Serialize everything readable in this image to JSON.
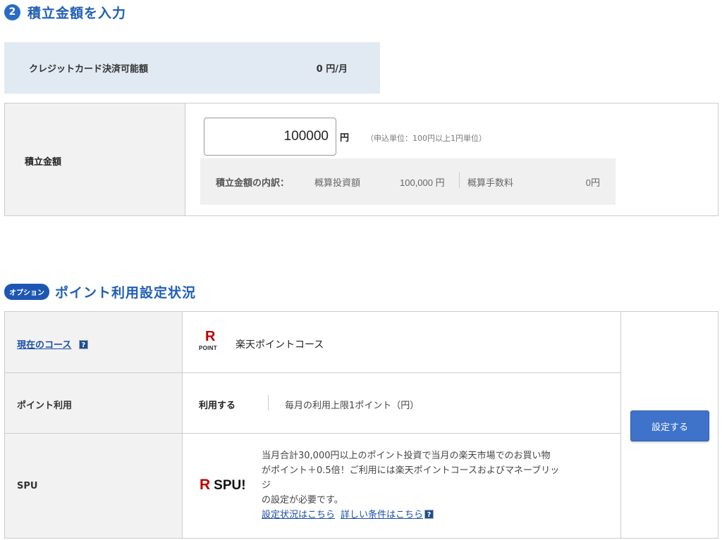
{
  "section1": {
    "step_number": "2",
    "title": "積立金額を入力"
  },
  "credit": {
    "label": "クレジットカード決済可能額",
    "value": "0 円/月"
  },
  "amount": {
    "label": "積立金額",
    "input_value": "100000",
    "unit": "円",
    "note": "（申込単位：100円以上1円単位）",
    "breakdown": {
      "title": "積立金額の内訳：",
      "investment_label": "概算投資額",
      "investment_value": "100,000 円",
      "fee_label": "概算手数料",
      "fee_value": "0円"
    }
  },
  "section2": {
    "badge": "オプション",
    "title": "ポイント利用設定状況"
  },
  "points": {
    "current_course_label": "現在のコース",
    "help_icon": "?",
    "course_logo_letter": "R",
    "course_logo_text": "POINT",
    "course_name": "楽天ポイントコース",
    "usage_label": "ポイント利用",
    "usage_value": "利用する",
    "usage_limit": "毎月の利用上限1ポイント（円）",
    "spu_label": "SPU",
    "spu_logo_letter": "R",
    "spu_logo_text": "SPU!",
    "spu_desc_1": "当月合計30,000円以上のポイント投資で当月の楽天市場でのお買い物",
    "spu_desc_2": "がポイント＋0.5倍！ご利用には楽天ポイントコースおよびマネーブリッ",
    "spu_desc_3": "ジ",
    "spu_desc_4": "の設定が必要です。",
    "spu_link_status": "設定状況はこちら",
    "spu_link_details": "詳しい条件はこちら",
    "set_button": "設定する"
  }
}
